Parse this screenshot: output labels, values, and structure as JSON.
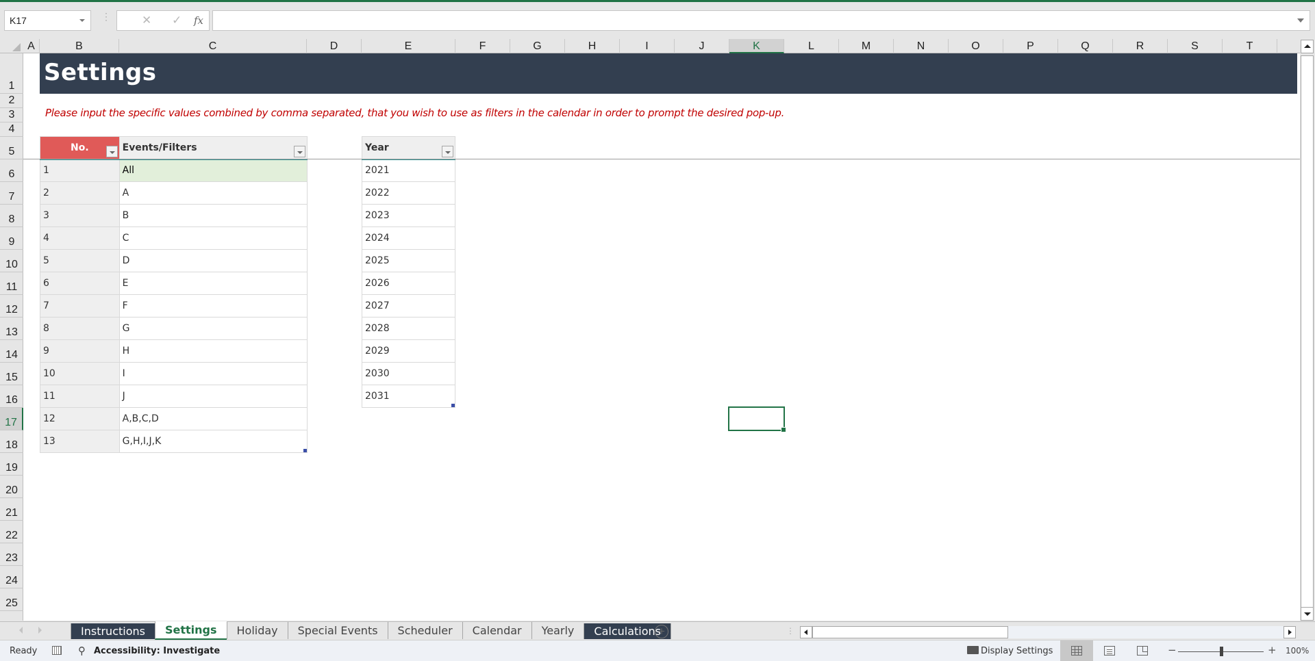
{
  "formula_bar": {
    "name_box": "K17",
    "cancel_icon": "✕",
    "enter_icon": "✓",
    "fx_label": "fx",
    "formula_value": ""
  },
  "columns": [
    "A",
    "B",
    "C",
    "D",
    "E",
    "F",
    "G",
    "H",
    "I",
    "J",
    "K",
    "L",
    "M",
    "N",
    "O",
    "P",
    "Q",
    "R",
    "S",
    "T"
  ],
  "selected_column": "K",
  "rows": [
    "1",
    "2",
    "3",
    "4",
    "5",
    "6",
    "7",
    "8",
    "9",
    "10",
    "11",
    "12",
    "13",
    "14",
    "15",
    "16",
    "17",
    "18",
    "19",
    "20",
    "21",
    "22",
    "23",
    "24",
    "25"
  ],
  "selected_row": "17",
  "sheet": {
    "title": "Settings",
    "note": "Please input the specific values combined by comma separated, that you wish to use as filters in the calendar in order to prompt the desired pop-up.",
    "colors": {
      "banner": "#333f50",
      "note": "#c00000",
      "no_header": "#e05a58",
      "highlight_row": "#e2efda",
      "accent": "#217346"
    },
    "events_table": {
      "headers": [
        "No.",
        "Events/Filters"
      ],
      "rows": [
        {
          "no": "1",
          "value": "All"
        },
        {
          "no": "2",
          "value": "A"
        },
        {
          "no": "3",
          "value": "B"
        },
        {
          "no": "4",
          "value": "C"
        },
        {
          "no": "5",
          "value": "D"
        },
        {
          "no": "6",
          "value": "E"
        },
        {
          "no": "7",
          "value": "F"
        },
        {
          "no": "8",
          "value": "G"
        },
        {
          "no": "9",
          "value": "H"
        },
        {
          "no": "10",
          "value": "I"
        },
        {
          "no": "11",
          "value": "J"
        },
        {
          "no": "12",
          "value": "A,B,C,D"
        },
        {
          "no": "13",
          "value": "G,H,I,J,K"
        }
      ]
    },
    "year_table": {
      "header": "Year",
      "rows": [
        "2021",
        "2022",
        "2023",
        "2024",
        "2025",
        "2026",
        "2027",
        "2028",
        "2029",
        "2030",
        "2031"
      ]
    }
  },
  "tabs": [
    {
      "label": "Instructions",
      "style": "dark"
    },
    {
      "label": "Settings",
      "style": "active"
    },
    {
      "label": "Holiday",
      "style": "normal"
    },
    {
      "label": "Special Events",
      "style": "normal"
    },
    {
      "label": "Scheduler",
      "style": "normal"
    },
    {
      "label": "Calendar",
      "style": "normal"
    },
    {
      "label": "Yearly",
      "style": "normal"
    },
    {
      "label": "Calculations",
      "style": "dark"
    }
  ],
  "add_sheet_icon": "+",
  "status_bar": {
    "ready": "Ready",
    "accessibility": "Accessibility: Investigate",
    "display_settings": "Display Settings",
    "zoom_minus": "−",
    "zoom_plus": "+",
    "zoom_level": "100%",
    "zoom_fraction": 0.5
  }
}
